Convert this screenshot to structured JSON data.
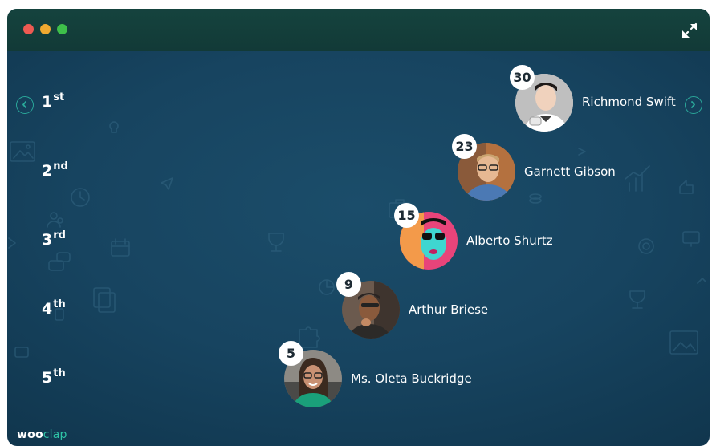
{
  "window": {
    "controls": [
      "close",
      "minimize",
      "maximize"
    ],
    "expand_icon": "expand-icon"
  },
  "navigation": {
    "prev_icon": "chevron-left-icon",
    "next_icon": "chevron-right-icon"
  },
  "leaderboard": [
    {
      "rank_num": "1",
      "rank_suffix": "st",
      "score": "30",
      "name": "Richmond Swift"
    },
    {
      "rank_num": "2",
      "rank_suffix": "nd",
      "score": "23",
      "name": "Garnett Gibson"
    },
    {
      "rank_num": "3",
      "rank_suffix": "rd",
      "score": "15",
      "name": "Alberto Shurtz"
    },
    {
      "rank_num": "4",
      "rank_suffix": "th",
      "score": "9",
      "name": "Arthur Briese"
    },
    {
      "rank_num": "5",
      "rank_suffix": "th",
      "score": "5",
      "name": "Ms. Oleta Buckridge"
    }
  ],
  "brand": {
    "logo_main": "woo",
    "logo_accent": "clap"
  },
  "colors": {
    "titlebar": "#133f3b",
    "background": "#174460",
    "accent": "#2aa89a",
    "score_badge": "#ffffff"
  }
}
